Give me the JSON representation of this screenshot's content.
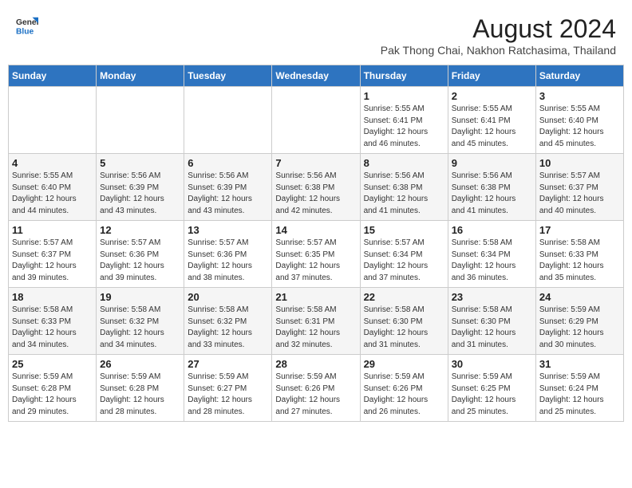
{
  "header": {
    "logo_general": "General",
    "logo_blue": "Blue",
    "main_title": "August 2024",
    "subtitle": "Pak Thong Chai, Nakhon Ratchasima, Thailand"
  },
  "weekdays": [
    "Sunday",
    "Monday",
    "Tuesday",
    "Wednesday",
    "Thursday",
    "Friday",
    "Saturday"
  ],
  "weeks": [
    [
      {
        "day": "",
        "info": ""
      },
      {
        "day": "",
        "info": ""
      },
      {
        "day": "",
        "info": ""
      },
      {
        "day": "",
        "info": ""
      },
      {
        "day": "1",
        "info": "Sunrise: 5:55 AM\nSunset: 6:41 PM\nDaylight: 12 hours\nand 46 minutes."
      },
      {
        "day": "2",
        "info": "Sunrise: 5:55 AM\nSunset: 6:41 PM\nDaylight: 12 hours\nand 45 minutes."
      },
      {
        "day": "3",
        "info": "Sunrise: 5:55 AM\nSunset: 6:40 PM\nDaylight: 12 hours\nand 45 minutes."
      }
    ],
    [
      {
        "day": "4",
        "info": "Sunrise: 5:55 AM\nSunset: 6:40 PM\nDaylight: 12 hours\nand 44 minutes."
      },
      {
        "day": "5",
        "info": "Sunrise: 5:56 AM\nSunset: 6:39 PM\nDaylight: 12 hours\nand 43 minutes."
      },
      {
        "day": "6",
        "info": "Sunrise: 5:56 AM\nSunset: 6:39 PM\nDaylight: 12 hours\nand 43 minutes."
      },
      {
        "day": "7",
        "info": "Sunrise: 5:56 AM\nSunset: 6:38 PM\nDaylight: 12 hours\nand 42 minutes."
      },
      {
        "day": "8",
        "info": "Sunrise: 5:56 AM\nSunset: 6:38 PM\nDaylight: 12 hours\nand 41 minutes."
      },
      {
        "day": "9",
        "info": "Sunrise: 5:56 AM\nSunset: 6:38 PM\nDaylight: 12 hours\nand 41 minutes."
      },
      {
        "day": "10",
        "info": "Sunrise: 5:57 AM\nSunset: 6:37 PM\nDaylight: 12 hours\nand 40 minutes."
      }
    ],
    [
      {
        "day": "11",
        "info": "Sunrise: 5:57 AM\nSunset: 6:37 PM\nDaylight: 12 hours\nand 39 minutes."
      },
      {
        "day": "12",
        "info": "Sunrise: 5:57 AM\nSunset: 6:36 PM\nDaylight: 12 hours\nand 39 minutes."
      },
      {
        "day": "13",
        "info": "Sunrise: 5:57 AM\nSunset: 6:36 PM\nDaylight: 12 hours\nand 38 minutes."
      },
      {
        "day": "14",
        "info": "Sunrise: 5:57 AM\nSunset: 6:35 PM\nDaylight: 12 hours\nand 37 minutes."
      },
      {
        "day": "15",
        "info": "Sunrise: 5:57 AM\nSunset: 6:34 PM\nDaylight: 12 hours\nand 37 minutes."
      },
      {
        "day": "16",
        "info": "Sunrise: 5:58 AM\nSunset: 6:34 PM\nDaylight: 12 hours\nand 36 minutes."
      },
      {
        "day": "17",
        "info": "Sunrise: 5:58 AM\nSunset: 6:33 PM\nDaylight: 12 hours\nand 35 minutes."
      }
    ],
    [
      {
        "day": "18",
        "info": "Sunrise: 5:58 AM\nSunset: 6:33 PM\nDaylight: 12 hours\nand 34 minutes."
      },
      {
        "day": "19",
        "info": "Sunrise: 5:58 AM\nSunset: 6:32 PM\nDaylight: 12 hours\nand 34 minutes."
      },
      {
        "day": "20",
        "info": "Sunrise: 5:58 AM\nSunset: 6:32 PM\nDaylight: 12 hours\nand 33 minutes."
      },
      {
        "day": "21",
        "info": "Sunrise: 5:58 AM\nSunset: 6:31 PM\nDaylight: 12 hours\nand 32 minutes."
      },
      {
        "day": "22",
        "info": "Sunrise: 5:58 AM\nSunset: 6:30 PM\nDaylight: 12 hours\nand 31 minutes."
      },
      {
        "day": "23",
        "info": "Sunrise: 5:58 AM\nSunset: 6:30 PM\nDaylight: 12 hours\nand 31 minutes."
      },
      {
        "day": "24",
        "info": "Sunrise: 5:59 AM\nSunset: 6:29 PM\nDaylight: 12 hours\nand 30 minutes."
      }
    ],
    [
      {
        "day": "25",
        "info": "Sunrise: 5:59 AM\nSunset: 6:28 PM\nDaylight: 12 hours\nand 29 minutes."
      },
      {
        "day": "26",
        "info": "Sunrise: 5:59 AM\nSunset: 6:28 PM\nDaylight: 12 hours\nand 28 minutes."
      },
      {
        "day": "27",
        "info": "Sunrise: 5:59 AM\nSunset: 6:27 PM\nDaylight: 12 hours\nand 28 minutes."
      },
      {
        "day": "28",
        "info": "Sunrise: 5:59 AM\nSunset: 6:26 PM\nDaylight: 12 hours\nand 27 minutes."
      },
      {
        "day": "29",
        "info": "Sunrise: 5:59 AM\nSunset: 6:26 PM\nDaylight: 12 hours\nand 26 minutes."
      },
      {
        "day": "30",
        "info": "Sunrise: 5:59 AM\nSunset: 6:25 PM\nDaylight: 12 hours\nand 25 minutes."
      },
      {
        "day": "31",
        "info": "Sunrise: 5:59 AM\nSunset: 6:24 PM\nDaylight: 12 hours\nand 25 minutes."
      }
    ]
  ]
}
